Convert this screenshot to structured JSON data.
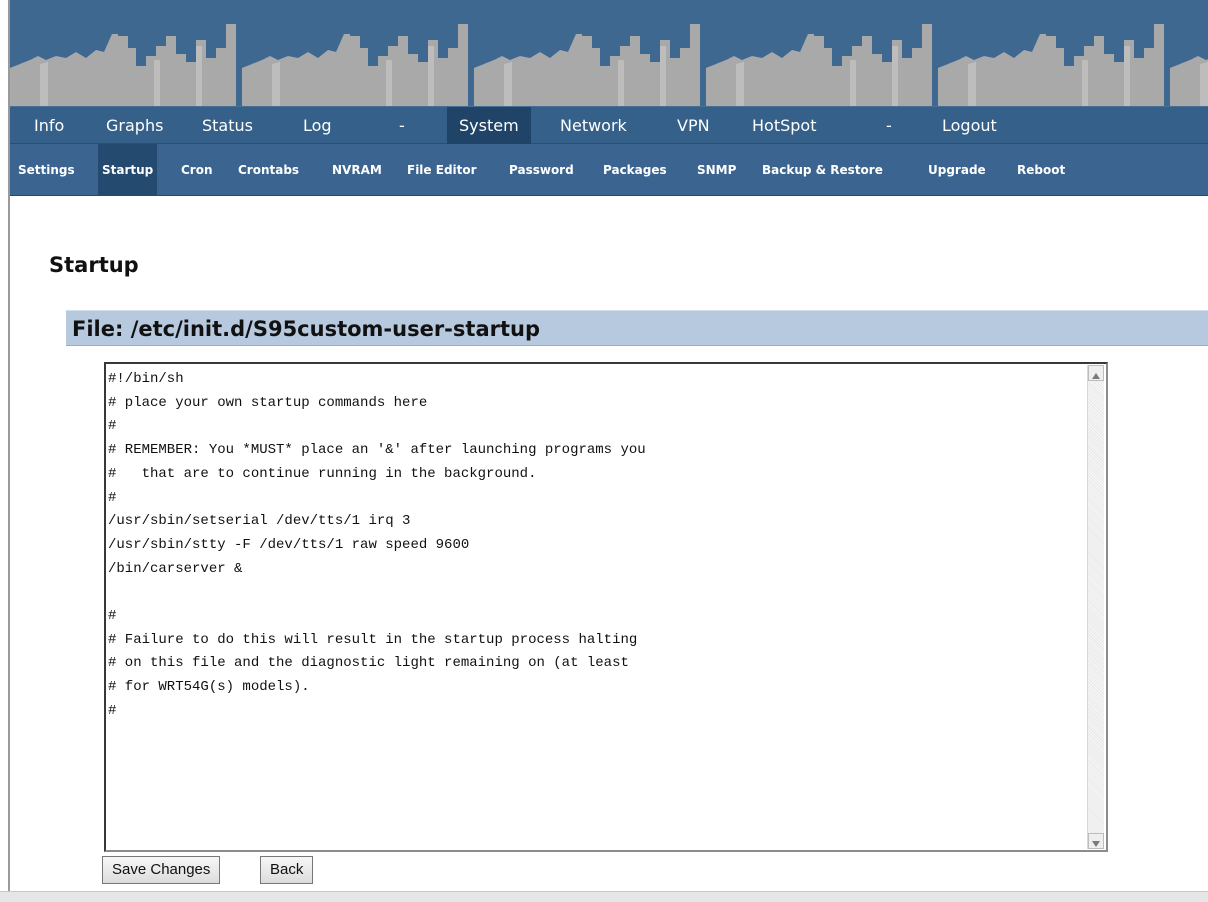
{
  "top_nav": [
    {
      "label": "Info",
      "active": false
    },
    {
      "label": "Graphs",
      "active": false
    },
    {
      "label": "Status",
      "active": false
    },
    {
      "label": "Log",
      "active": false
    },
    {
      "label": "-",
      "active": false
    },
    {
      "label": "System",
      "active": true
    },
    {
      "label": "Network",
      "active": false
    },
    {
      "label": "VPN",
      "active": false
    },
    {
      "label": "HotSpot",
      "active": false
    },
    {
      "label": "-",
      "active": false
    },
    {
      "label": "Logout",
      "active": false
    }
  ],
  "sub_nav": [
    {
      "label": "Settings",
      "active": false
    },
    {
      "label": "Startup",
      "active": true
    },
    {
      "label": "Cron",
      "active": false
    },
    {
      "label": "Crontabs",
      "active": false
    },
    {
      "label": "NVRAM",
      "active": false
    },
    {
      "label": "File Editor",
      "active": false
    },
    {
      "label": "Password",
      "active": false
    },
    {
      "label": "Packages",
      "active": false
    },
    {
      "label": "SNMP",
      "active": false
    },
    {
      "label": "Backup & Restore",
      "active": false
    },
    {
      "label": "Upgrade",
      "active": false
    },
    {
      "label": "Reboot",
      "active": false
    }
  ],
  "page": {
    "title": "Startup",
    "file_label": "File: /etc/init.d/S95custom-user-startup"
  },
  "editor": {
    "content": "#!/bin/sh\n# place your own startup commands here\n#\n# REMEMBER: You *MUST* place an '&' after launching programs you\n#   that are to continue running in the background.\n#\n/usr/sbin/setserial /dev/tts/1 irq 3\n/usr/sbin/stty -F /dev/tts/1 raw speed 9600\n/bin/carserver &\n\n#\n# Failure to do this will result in the startup process halting\n# on this file and the diagnostic light remaining on (at least\n# for WRT54G(s) models).\n#"
  },
  "buttons": {
    "save": "Save Changes",
    "back": "Back"
  },
  "colors": {
    "nav_bar": "#35608a",
    "subnav_bar": "#3b6590",
    "active_tab": "#1f4468",
    "file_header": "#b7c9de",
    "banner_sky": "#3f6890",
    "skyline": "#a7a7a7"
  },
  "icons": {
    "scroll_up": "triangle-up-icon",
    "scroll_down": "triangle-down-icon"
  }
}
